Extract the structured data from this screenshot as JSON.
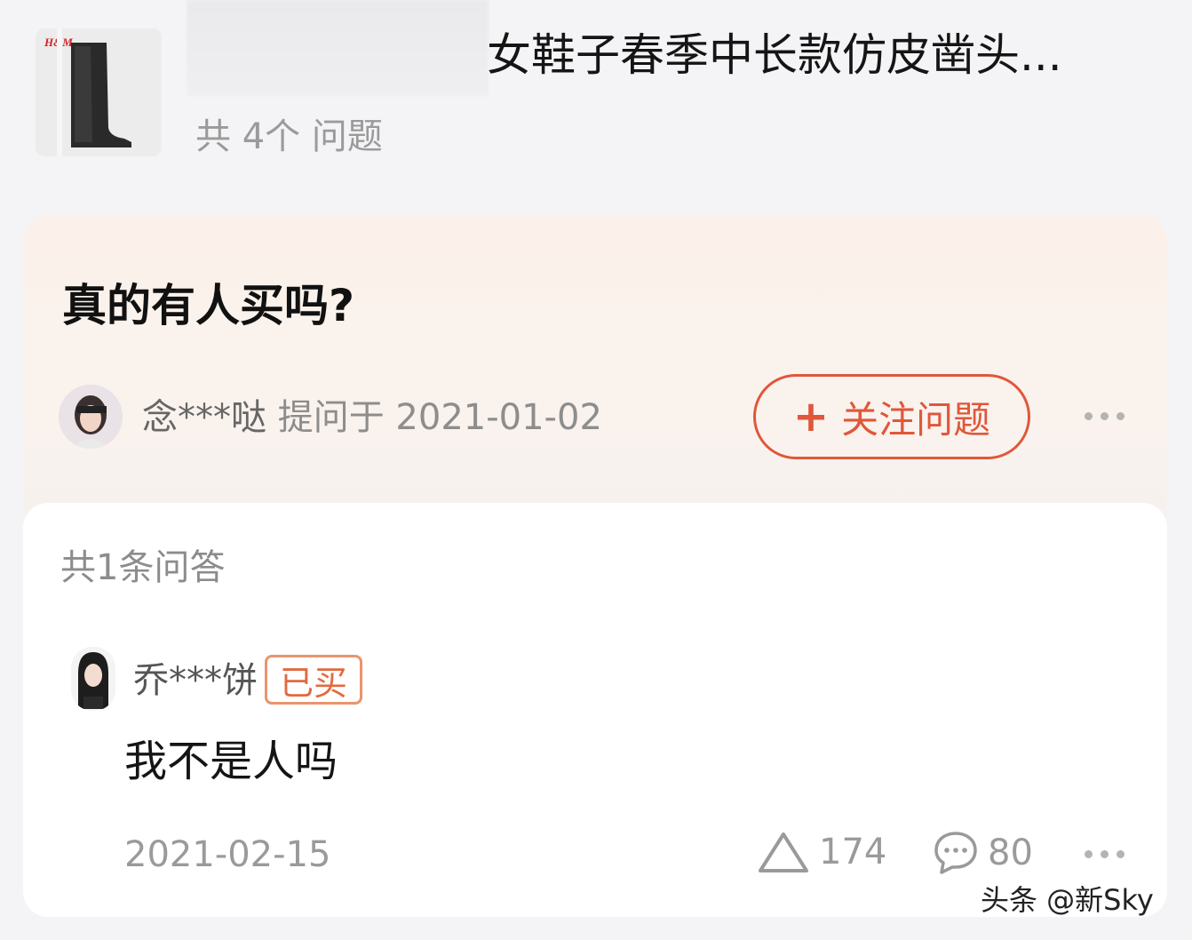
{
  "product": {
    "brand_logo": "H&M",
    "title": "女鞋子春季中长款仿皮凿头...",
    "question_count": "共 4个 问题"
  },
  "question": {
    "title": "真的有人买吗?",
    "asker_name": "念***哒",
    "asked_text": "提问于 2021-01-02",
    "follow_label": "关注问题",
    "follow_icon": "plus-icon"
  },
  "answers": {
    "count_label": "共1条问答",
    "items": [
      {
        "user_name": "乔***饼",
        "badge": "已买",
        "text": "我不是人吗",
        "date": "2021-02-15",
        "likes": "174",
        "comments": "80"
      }
    ]
  },
  "watermark": "头条 @新Sky",
  "colors": {
    "accent": "#e0573a",
    "badge": "#e16a3f",
    "muted": "#9a9a9a"
  }
}
